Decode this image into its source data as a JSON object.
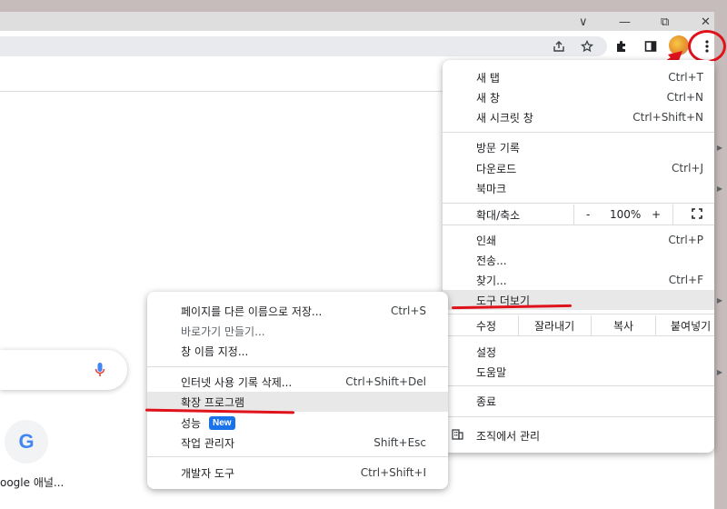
{
  "window": {
    "minimize_glyph": "∨",
    "minimize2_glyph": "—",
    "restore_glyph": "⧉",
    "close_glyph": "✕"
  },
  "toolbar": {
    "share_icon": "share-icon",
    "star_icon": "bookmark-star-icon",
    "extensions_icon": "puzzle-icon",
    "sidepanel_icon": "side-panel-icon",
    "menu_icon": "kebab-menu-icon"
  },
  "page": {
    "shortcut_label": "oogle 애널..."
  },
  "main_menu": {
    "new_tab": {
      "label": "새 탭",
      "accel": "Ctrl+T"
    },
    "new_window": {
      "label": "새 창",
      "accel": "Ctrl+N"
    },
    "incognito": {
      "label": "새 시크릿 창",
      "accel": "Ctrl+Shift+N"
    },
    "history": {
      "label": "방문 기록"
    },
    "downloads": {
      "label": "다운로드",
      "accel": "Ctrl+J"
    },
    "bookmarks": {
      "label": "북마크"
    },
    "zoom": {
      "label": "확대/축소",
      "minus": "-",
      "value": "100%",
      "plus": "+",
      "fullscreen": "⛶"
    },
    "print": {
      "label": "인쇄",
      "accel": "Ctrl+P"
    },
    "cast": {
      "label": "전송..."
    },
    "find": {
      "label": "찾기...",
      "accel": "Ctrl+F"
    },
    "more_tools": {
      "label": "도구 더보기"
    },
    "edit": {
      "label": "수정",
      "cut": "잘라내기",
      "copy": "복사",
      "paste": "붙여넣기"
    },
    "settings": {
      "label": "설정"
    },
    "help": {
      "label": "도움말"
    },
    "exit": {
      "label": "종료"
    },
    "managed": {
      "label": "조직에서 관리"
    }
  },
  "sub_menu": {
    "save_page": {
      "label": "페이지를 다른 이름으로 저장...",
      "accel": "Ctrl+S"
    },
    "create_shortcut": {
      "label": "바로가기 만들기..."
    },
    "name_window": {
      "label": "창 이름 지정..."
    },
    "clear_data": {
      "label": "인터넷 사용 기록 삭제...",
      "accel": "Ctrl+Shift+Del"
    },
    "extensions": {
      "label": "확장 프로그램"
    },
    "performance": {
      "label": "성능",
      "badge": "New"
    },
    "task_manager": {
      "label": "작업 관리자",
      "accel": "Shift+Esc"
    },
    "dev_tools": {
      "label": "개발자 도구",
      "accel": "Ctrl+Shift+I"
    }
  },
  "colors": {
    "annotation_red": "#e0121b",
    "accent_blue": "#1a73e8"
  }
}
